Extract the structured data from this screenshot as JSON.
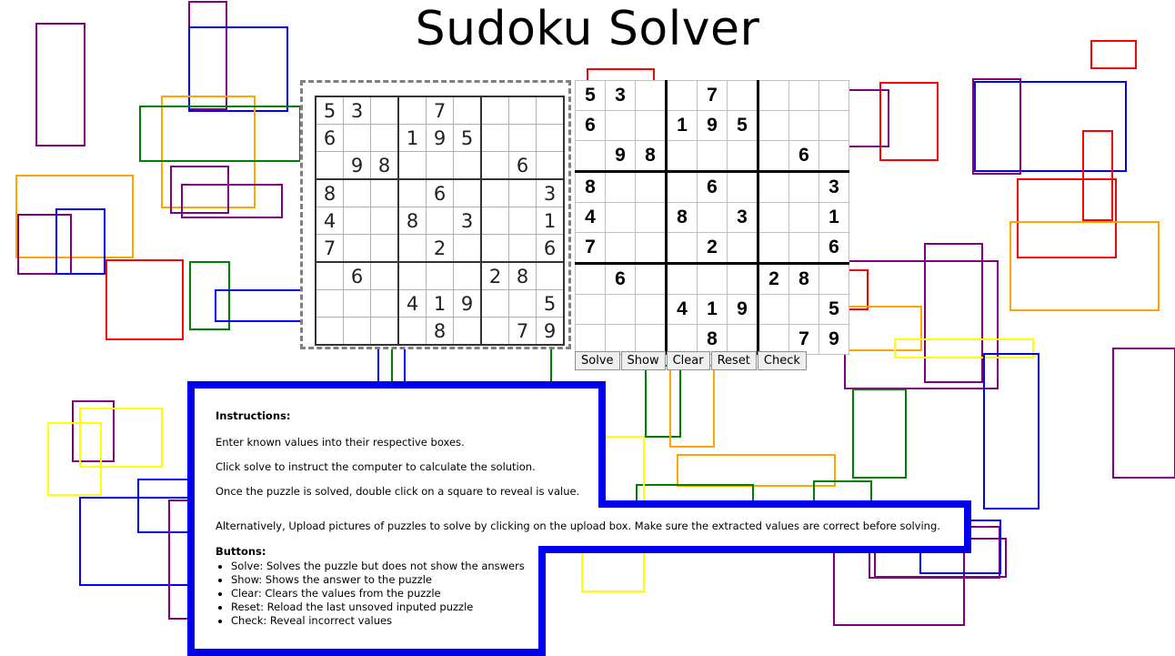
{
  "page": {
    "title": "Sudoku Solver"
  },
  "upload_image_grid": {
    "rows": [
      [
        "5",
        "3",
        "",
        "",
        "7",
        "",
        "",
        "",
        ""
      ],
      [
        "6",
        "",
        "",
        "1",
        "9",
        "5",
        "",
        "",
        ""
      ],
      [
        "",
        "9",
        "8",
        "",
        "",
        "",
        "",
        "6",
        ""
      ],
      [
        "8",
        "",
        "",
        "",
        "6",
        "",
        "",
        "",
        "3"
      ],
      [
        "4",
        "",
        "",
        "8",
        "",
        "3",
        "",
        "",
        "1"
      ],
      [
        "7",
        "",
        "",
        "",
        "2",
        "",
        "",
        "",
        "6"
      ],
      [
        "",
        "6",
        "",
        "",
        "",
        "",
        "2",
        "8",
        ""
      ],
      [
        "",
        "",
        "",
        "4",
        "1",
        "9",
        "",
        "",
        "5"
      ],
      [
        "",
        "",
        "",
        "",
        "8",
        "",
        "",
        "7",
        "9"
      ]
    ]
  },
  "solver_grid": {
    "rows": [
      [
        "5",
        "3",
        "",
        "",
        "7",
        "",
        "",
        "",
        ""
      ],
      [
        "6",
        "",
        "",
        "1",
        "9",
        "5",
        "",
        "",
        ""
      ],
      [
        "",
        "9",
        "8",
        "",
        "",
        "",
        "",
        "6",
        ""
      ],
      [
        "8",
        "",
        "",
        "",
        "6",
        "",
        "",
        "",
        "3"
      ],
      [
        "4",
        "",
        "",
        "8",
        "",
        "3",
        "",
        "",
        "1"
      ],
      [
        "7",
        "",
        "",
        "",
        "2",
        "",
        "",
        "",
        "6"
      ],
      [
        "",
        "6",
        "",
        "",
        "",
        "",
        "2",
        "8",
        ""
      ],
      [
        "",
        "",
        "",
        "4",
        "1",
        "9",
        "",
        "",
        "5"
      ],
      [
        "",
        "",
        "",
        "",
        "8",
        "",
        "",
        "7",
        "9"
      ]
    ]
  },
  "buttons": {
    "solve": "Solve",
    "show": "Show",
    "clear": "Clear",
    "reset": "Reset",
    "check": "Check"
  },
  "instructions": {
    "heading": "Instructions:",
    "line1": "Enter known values into their respective boxes.",
    "line2": "Click solve to instruct the computer to calculate the solution.",
    "line3": "Once the puzzle is solved, double click on a square to reveal is value.",
    "line4": "Alternatively, Upload pictures of puzzles to solve by clicking on the upload box. Make sure the extracted values are correct before solving.",
    "buttons_heading": "Buttons:",
    "button_help": [
      "Solve: Solves the puzzle but does not show the answers",
      "Show: Shows the answer to the puzzle",
      "Clear: Clears the values from the puzzle",
      "Reset: Reload the last unsoved inputed puzzle",
      "Check: Reveal incorrect values"
    ]
  },
  "colors": {
    "panel_border": "#0000ee",
    "decor": [
      "#800080",
      "#0000ff",
      "#ffa500",
      "#008000",
      "#ff0000",
      "#ffff00"
    ]
  }
}
